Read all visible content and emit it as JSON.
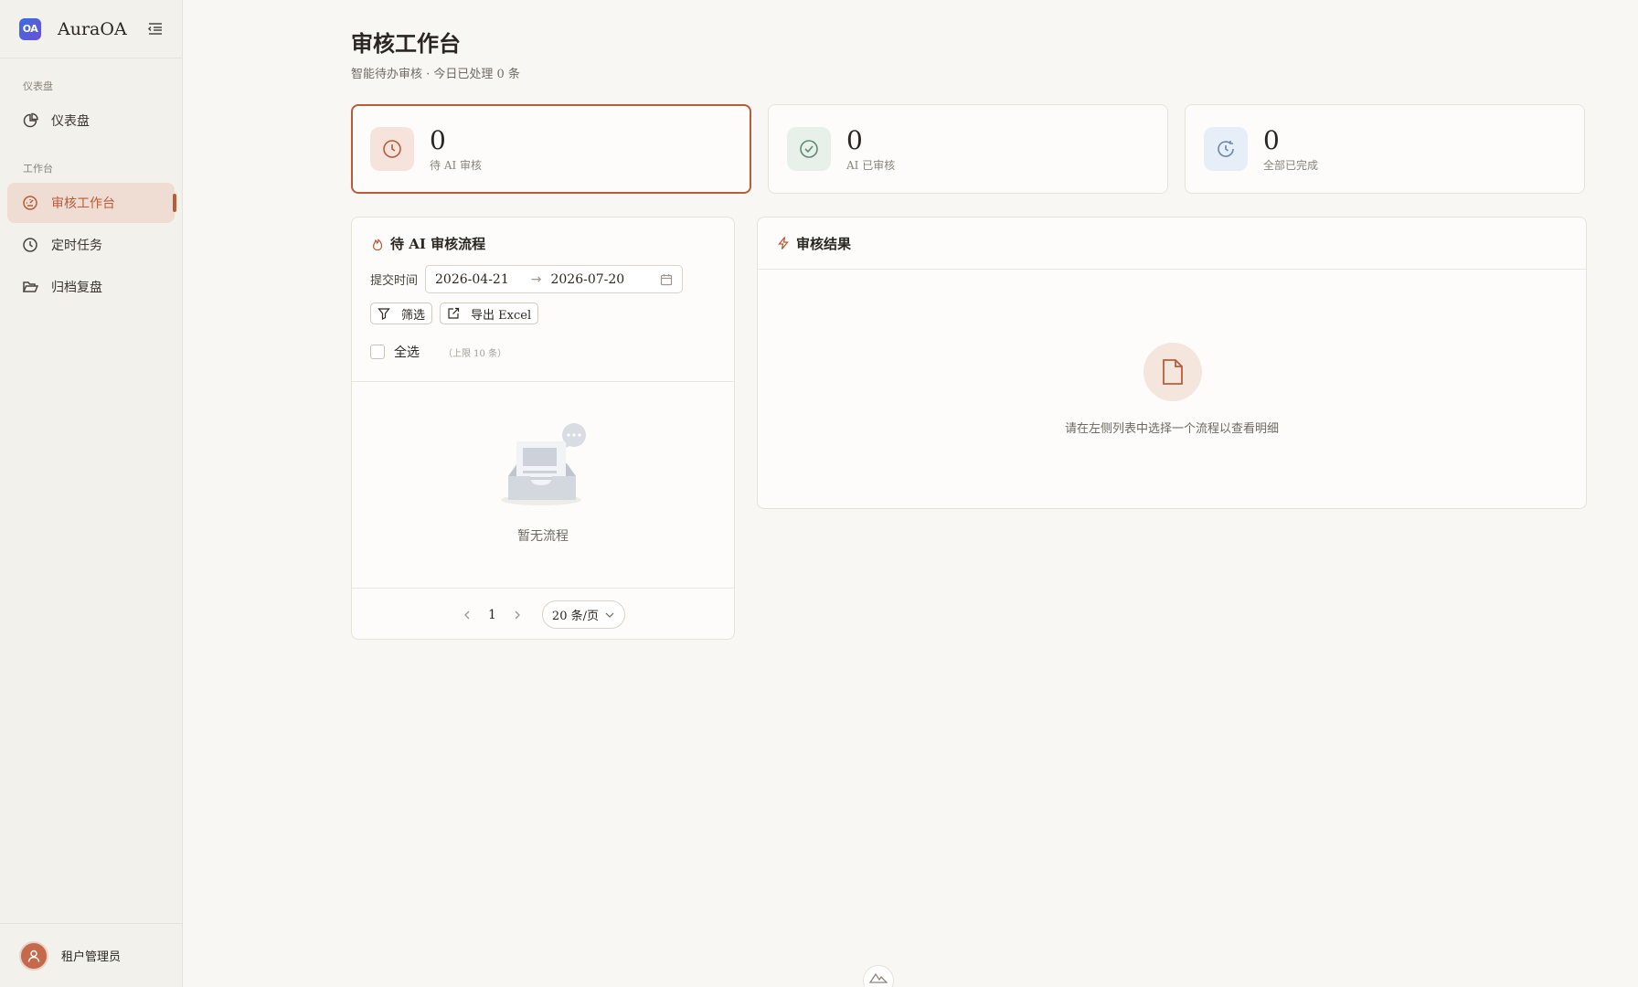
{
  "app": {
    "name": "AuraOA",
    "logo_text": "OA"
  },
  "sidebar": {
    "groups": [
      {
        "title": "仪表盘",
        "items": [
          {
            "label": "仪表盘",
            "icon": "pie-chart-icon"
          }
        ]
      },
      {
        "title": "工作台",
        "items": [
          {
            "label": "审核工作台",
            "icon": "dashboard-gauge-icon",
            "active": true
          },
          {
            "label": "定时任务",
            "icon": "clock-icon"
          },
          {
            "label": "归档复盘",
            "icon": "folder-open-icon"
          }
        ]
      }
    ],
    "user": {
      "name": "租户管理员"
    }
  },
  "page": {
    "title": "审核工作台",
    "subtitle": "智能待办审核 · 今日已处理 0 条"
  },
  "stats": [
    {
      "value": "0",
      "label": "待 AI 审核",
      "active": true,
      "icon": "clock-icon",
      "color": "#b85c3a",
      "bg": "#f6e4dc"
    },
    {
      "value": "0",
      "label": "AI 已审核",
      "icon": "check-circle-icon",
      "color": "#5f8a6f",
      "bg": "#e7f1ea"
    },
    {
      "value": "0",
      "label": "全部已完成",
      "icon": "history-icon",
      "color": "#6b86a8",
      "bg": "#e6eef8"
    }
  ],
  "pending_panel": {
    "title": "待 AI 审核流程",
    "filter_label": "提交时间",
    "date_start": "2026-04-21",
    "date_sep": "→",
    "date_end": "2026-07-20",
    "filter_button": "筛选",
    "export_button": "导出 Excel",
    "select_all": "全选",
    "limit_note": "（上限 10 条）",
    "empty_text": "暂无流程",
    "pagination": {
      "current_page": "1",
      "page_size": "20 条/页"
    }
  },
  "result_panel": {
    "title": "审核结果",
    "empty_text": "请在左侧列表中选择一个流程以查看明细"
  },
  "colors": {
    "accent": "#b85c3a",
    "background": "#f8f7f4",
    "sidebar": "#f3f1ec"
  }
}
